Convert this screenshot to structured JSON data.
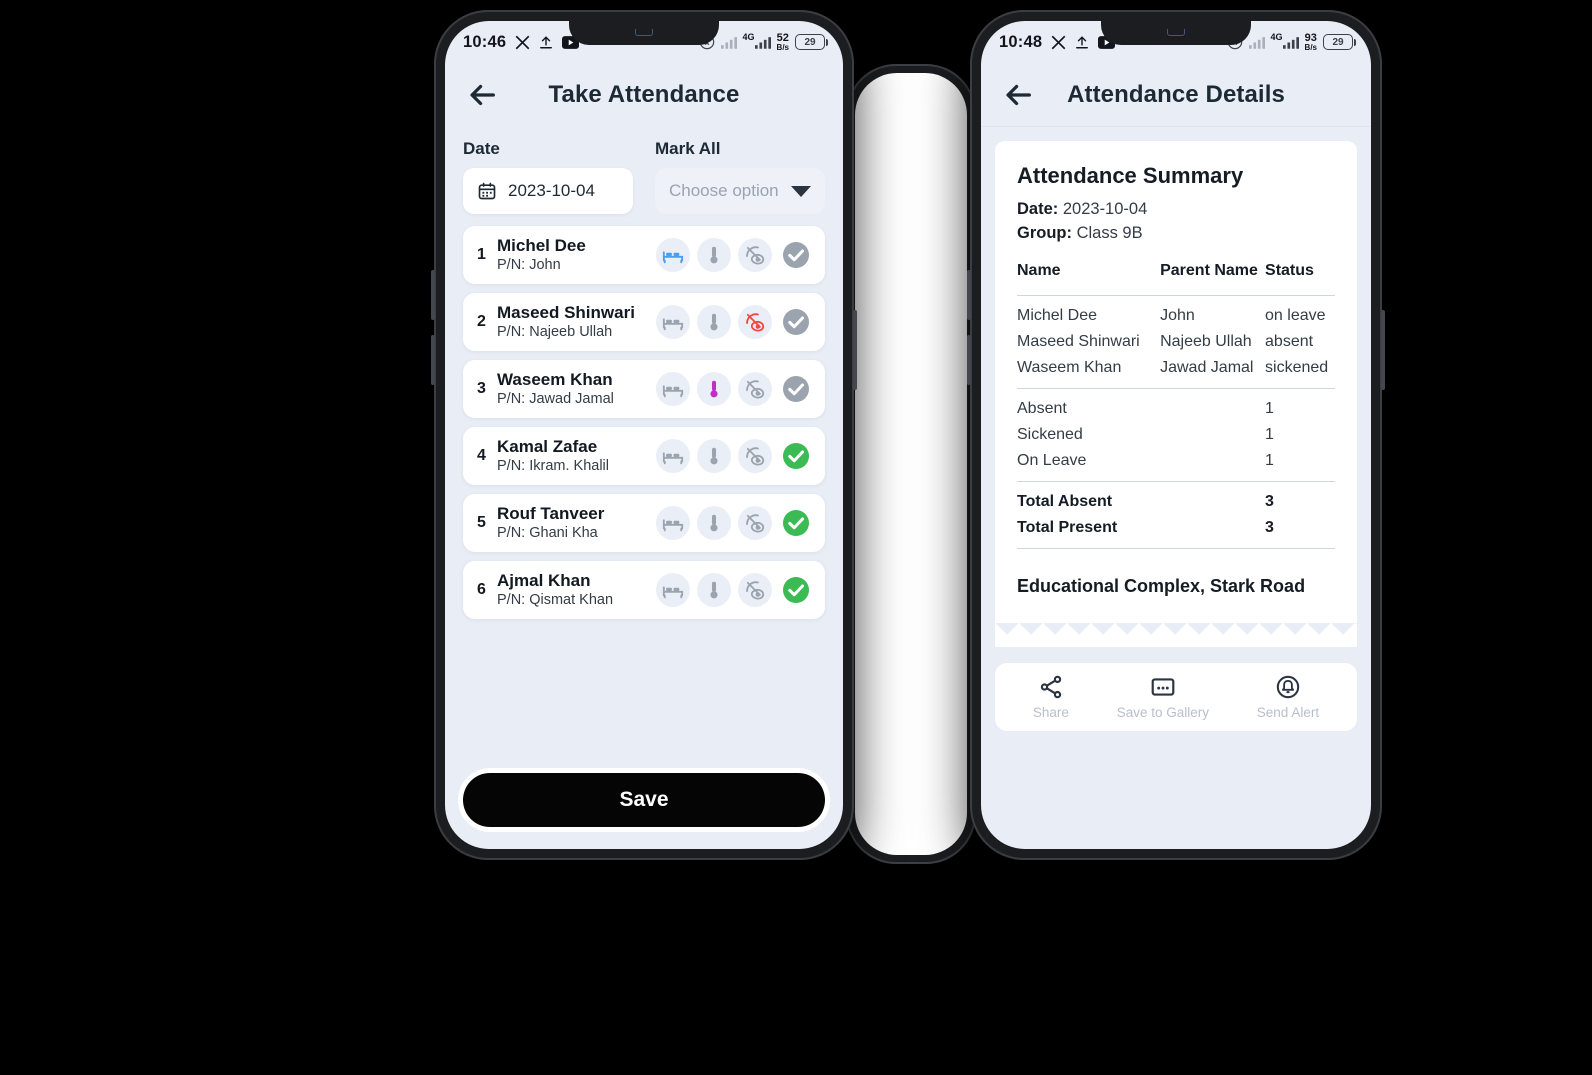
{
  "phone_left": {
    "statusbar": {
      "time": "10:46",
      "left_icons": [
        "x-icon",
        "upload-icon",
        "youtube-icon"
      ],
      "right_icons": [
        "location-icon",
        "signal-bars-icon",
        "signal-bars-icon"
      ],
      "network": "4G",
      "data_speed_value": "52",
      "data_speed_unit": "B/s",
      "battery": "29"
    },
    "appbar": {
      "title": "Take Attendance",
      "back_icon": "back-arrow-icon"
    },
    "date_field": {
      "label": "Date",
      "value": "2023-10-04",
      "icon": "calendar-icon"
    },
    "mark_all_field": {
      "label": "Mark All",
      "placeholder": "Choose option",
      "icon": "chevron-down-icon"
    },
    "students": [
      {
        "index": "1",
        "name": "Michel Dee",
        "parent": "P/N: John",
        "state": "leave"
      },
      {
        "index": "2",
        "name": "Maseed Shinwari",
        "parent": "P/N: Najeeb Ullah",
        "state": "absent"
      },
      {
        "index": "3",
        "name": "Waseem Khan",
        "parent": "P/N: Jawad Jamal",
        "state": "sick"
      },
      {
        "index": "4",
        "name": "Kamal Zafae",
        "parent": "P/N: Ikram. Khalil",
        "state": "present"
      },
      {
        "index": "5",
        "name": "Rouf Tanveer",
        "parent": "P/N: Ghani Kha",
        "state": "present"
      },
      {
        "index": "6",
        "name": "Ajmal Khan",
        "parent": "P/N: Qismat Khan",
        "state": "present"
      }
    ],
    "action_icons": [
      "bed-icon",
      "thermometer-icon",
      "eye-off-icon",
      "check-circle-icon"
    ],
    "save_button": "Save"
  },
  "phone_right": {
    "statusbar": {
      "time": "10:48",
      "network": "4G",
      "data_speed_value": "93",
      "data_speed_unit": "B/s",
      "battery": "29"
    },
    "appbar": {
      "title": "Attendance Details",
      "back_icon": "back-arrow-icon"
    },
    "summary": {
      "title": "Attendance Summary",
      "date_label": "Date:",
      "date_value": "2023-10-04",
      "group_label": "Group:",
      "group_value": "Class 9B",
      "columns": [
        "Name",
        "Parent Name",
        "Status"
      ],
      "rows": [
        {
          "name": "Michel Dee",
          "parent": "John",
          "status": "on leave"
        },
        {
          "name": "Maseed Shinwari",
          "parent": "Najeeb Ullah",
          "status": "absent"
        },
        {
          "name": "Waseem Khan",
          "parent": "Jawad Jamal",
          "status": "sickened"
        }
      ],
      "counts": [
        {
          "label": "Absent",
          "value": "1"
        },
        {
          "label": "Sickened",
          "value": "1"
        },
        {
          "label": "On Leave",
          "value": "1"
        }
      ],
      "totals": [
        {
          "label": "Total Absent",
          "value": "3"
        },
        {
          "label": "Total Present",
          "value": "3"
        }
      ],
      "address": "Educational Complex, Stark Road"
    },
    "actions": [
      {
        "label": "Share",
        "icon": "share-icon"
      },
      {
        "label": "Save to Gallery",
        "icon": "gallery-icon"
      },
      {
        "label": "Send Alert",
        "icon": "bell-icon"
      }
    ]
  },
  "colors": {
    "screen_bg": "#e9edf5",
    "accent_leave": "#4a9ef0",
    "accent_sick": "#bf2ec6",
    "accent_absent": "#f0483f",
    "accent_present": "#3cba54",
    "inactive": "#9aa3ae",
    "save_bg": "#050505"
  }
}
